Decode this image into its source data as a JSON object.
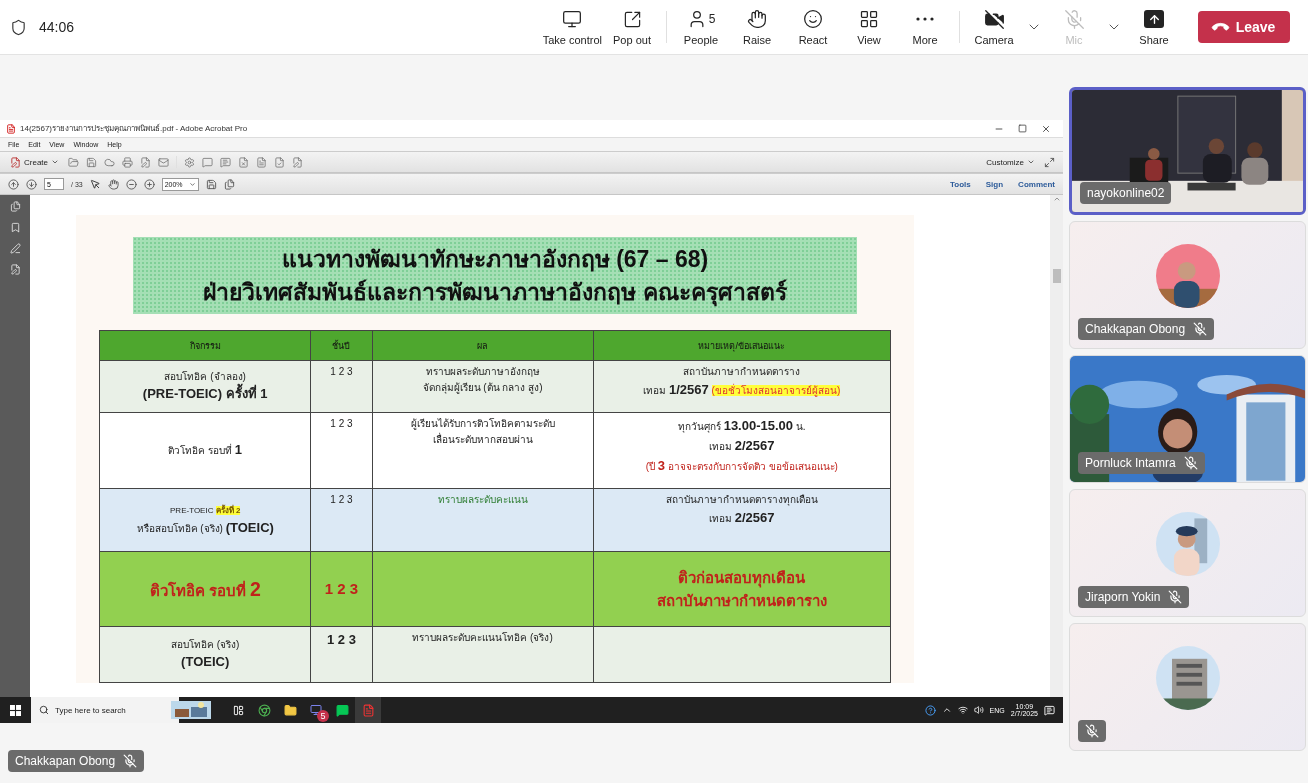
{
  "call": {
    "duration": "44:06"
  },
  "toolbar": [
    {
      "kind": "take-control",
      "label": "Take control"
    },
    {
      "kind": "pop-out",
      "label": "Pop out"
    },
    {
      "kind": "people",
      "label": "People",
      "count": "5"
    },
    {
      "kind": "raise",
      "label": "Raise"
    },
    {
      "kind": "react",
      "label": "React"
    },
    {
      "kind": "view",
      "label": "View"
    },
    {
      "kind": "more",
      "label": "More"
    }
  ],
  "devices": [
    {
      "kind": "camera",
      "label": "Camera",
      "on": false,
      "disabled": false
    },
    {
      "kind": "mic",
      "label": "Mic",
      "on": false,
      "disabled": true
    }
  ],
  "share": {
    "label": "Share"
  },
  "leave": {
    "label": "Leave"
  },
  "shared_screen": {
    "acrobat": {
      "title": "14(2567)รายงานการประชุมคุณภาพนิพนธ์.pdf - Adobe Acrobat Pro",
      "menu": [
        "File",
        "Edit",
        "View",
        "Window",
        "Help"
      ],
      "create": "Create",
      "customize": "Customize",
      "page": "5",
      "page_total": "/ 33",
      "zoom": "200%",
      "links": [
        "Tools",
        "Sign",
        "Comment"
      ]
    },
    "slide": {
      "title_lines": [
        "แนวทางพัฒนาทักษะภาษาอังกฤษ (67 – 68)",
        "ฝ่ายวิเทศสัมพันธ์และการพัฒนาภาษาอังกฤษ คณะครุศาสตร์"
      ],
      "table": {
        "columns": [
          "กิจกรรม",
          "ชั้นปี",
          "ผล",
          "หมายเหตุ/ข้อเสนอแนะ"
        ],
        "rows": [
          {
            "kind": "normal",
            "color": "#e9f0e7",
            "cells": [
              [
                {
                  "text": "สอบโทอิค (จำลอง)\n**(PRE-TOEIC) ครั้งที่ 1**",
                  "kind": "plain"
                }
              ],
              [
                {
                  "text": "1 2 3",
                  "kind": "plain"
                }
              ],
              [
                {
                  "text": "ทราบผลระดับภาษาอังกฤษ\nจัดกลุ่มผู้เรียน (ต้น กลาง สูง)",
                  "kind": "plain"
                }
              ],
              [
                {
                  "text": "สถาบันภาษากำหนดตาราง\nเทอม **1/2567** ",
                  "kind": "plain"
                },
                {
                  "text": "(ขอชั่วโมงสอนอาจารย์ผู้สอน)",
                  "kind": "mark-alert"
                }
              ]
            ]
          },
          {
            "kind": "normal",
            "color": "#ffffff",
            "cells": [
              [
                {
                  "text": "ติวโทอิค  รอบที่ **1**",
                  "kind": "plain"
                }
              ],
              [
                {
                  "text": "1 2 3",
                  "kind": "plain"
                }
              ],
              [
                {
                  "text": "ผู้เรียนได้รับการติวโทอิคตามระดับ\nเลื่อนระดับหากสอบผ่าน",
                  "kind": "plain"
                }
              ],
              [
                {
                  "text": "ทุกวันศุกร์ **13.00-15.00** น.\nเทอม **2/2567**\n",
                  "kind": "plain"
                },
                {
                  "text": "(ปี **3** อาจจะตรงกับการจัดติว ขอข้อเสนอแนะ)",
                  "kind": "alert"
                }
              ]
            ]
          },
          {
            "kind": "normal",
            "color": "#dce9f5",
            "cells": [
              [
                {
                  "text": "PRE-TOEIC ",
                  "kind": "small"
                },
                {
                  "text": "ครั้งที่ 2",
                  "kind": "mark"
                },
                {
                  "text": "\nหรือสอบโทอิค (จริง) **(TOEIC)**",
                  "kind": "plain"
                }
              ],
              [
                {
                  "text": "1 2 3",
                  "kind": "plain"
                }
              ],
              [
                {
                  "text": "ทราบผลระดับคะแนน",
                  "kind": "green"
                }
              ],
              [
                {
                  "text": "สถาบันภาษากำหนดตารางทุกเดือน\nเทอม **2/2567**",
                  "kind": "plain"
                }
              ]
            ]
          },
          {
            "kind": "banner",
            "color": "#92d050",
            "cells": [
              [
                {
                  "text": "ติวโทอิค  รอบที่ **2**",
                  "kind": "plain"
                }
              ],
              [
                {
                  "text": "1 2 3",
                  "kind": "plain"
                }
              ],
              [],
              [
                {
                  "text": "ติวก่อนสอบทุกเดือน\nสถาบันภาษากำหนดตาราง",
                  "kind": "plain"
                }
              ]
            ]
          },
          {
            "kind": "normal",
            "color": "#e9f0e7",
            "cells": [
              [
                {
                  "text": "สอบโทอิค (จริง)\n**(TOEIC)**",
                  "kind": "plain"
                }
              ],
              [
                {
                  "text": "**1 2 3**",
                  "kind": "plain"
                }
              ],
              [
                {
                  "text": "ทราบผลระดับคะแนนโทอิค (จริง)",
                  "kind": "plain"
                }
              ],
              []
            ]
          }
        ]
      }
    },
    "taskbar": {
      "search_placeholder": "Type here to search",
      "teams_badge": "5",
      "language": "ENG",
      "time": "10:09",
      "date": "2/7/2025"
    }
  },
  "participants": [
    {
      "kind": "video",
      "name": "nayokonline02",
      "muted": false,
      "selected": true
    },
    {
      "kind": "avatar",
      "name": "Chakkapan Obong",
      "muted": true,
      "selected": false
    },
    {
      "kind": "video",
      "name": "Pornluck Intamra",
      "muted": true,
      "selected": false
    },
    {
      "kind": "avatar",
      "name": "Jiraporn Yokin",
      "muted": true,
      "selected": false
    },
    {
      "kind": "avatar",
      "muted": true,
      "selected": false
    }
  ],
  "presenter": {
    "name": "Chakkapan Obong",
    "muted": true
  }
}
